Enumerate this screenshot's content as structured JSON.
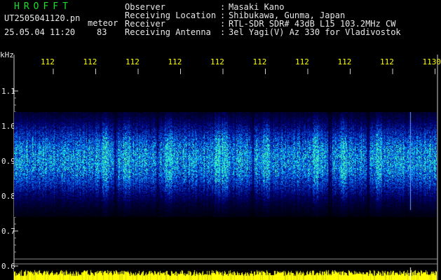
{
  "app": {
    "title": "HROFFT",
    "title_color": "#18e02a"
  },
  "file": {
    "name": "UT2505041120.pn",
    "tag": "meteor",
    "datetime": "25.05.04 11:20",
    "count": "83"
  },
  "meta": [
    {
      "label": "Observer",
      "value": "Masaki Kano"
    },
    {
      "label": "Receiving Location",
      "value": "Shibukawa, Gunma, Japan"
    },
    {
      "label": "Receiver",
      "value": "RTL-SDR SDR# 43dB L15 103.2MHz CW"
    },
    {
      "label": "Receiving Antenna",
      "value": "3el Yagi(V) Az 330 for Vladivostok"
    }
  ],
  "separator": ":",
  "axis": {
    "unit": "kHz",
    "y_ticks": [
      "1.1",
      "1.0",
      "0.9",
      "0.8",
      "0.7",
      "0.6"
    ],
    "x_ticks": [
      "112",
      "112",
      "112",
      "112",
      "112",
      "112",
      "112",
      "112",
      "112",
      "1130"
    ],
    "tick_color": "#ffff00"
  },
  "colors": {
    "background": "#000000",
    "text": "#e8e8e8",
    "spectrum_low": "#0a1a7a",
    "spectrum_mid": "#1f6dff",
    "spectrum_high": "#3cf0c0",
    "bar": "#ffff00",
    "gridline": "#8a8a8a"
  }
}
